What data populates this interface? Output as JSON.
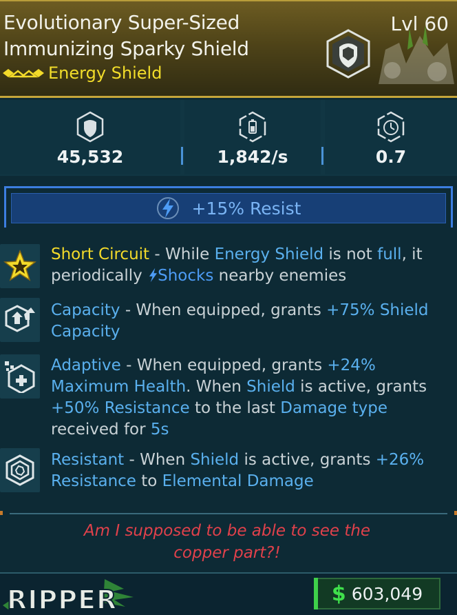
{
  "item": {
    "name_line1": "Evolutionary Super-Sized",
    "name_line2": "Immunizing Sparky Shield",
    "level": "Lvl 60",
    "type": "Energy Shield"
  },
  "stats": [
    {
      "icon": "shield-capacity-icon",
      "value": "45,532"
    },
    {
      "icon": "recharge-rate-icon",
      "value": "1,842/s"
    },
    {
      "icon": "recharge-delay-icon",
      "value": "0.7"
    }
  ],
  "banner": {
    "icon": "lightning-bolt-icon",
    "text": "+15% Resist"
  },
  "perks": [
    {
      "icon": "short-circuit-star-icon",
      "segments": [
        {
          "text": "Short Circuit",
          "style": "gold"
        },
        {
          "text": " - While ",
          "style": "plain"
        },
        {
          "text": "Energy Shield",
          "style": "blue"
        },
        {
          "text": " is not ",
          "style": "plain"
        },
        {
          "text": "full",
          "style": "blue"
        },
        {
          "text": ", it periodically ",
          "style": "plain"
        },
        {
          "text": "Shocks",
          "style": "shock"
        },
        {
          "text": " nearby enemies",
          "style": "plain"
        }
      ]
    },
    {
      "icon": "capacity-icon",
      "segments": [
        {
          "text": "Capacity",
          "style": "blue"
        },
        {
          "text": " - When equipped, grants ",
          "style": "plain"
        },
        {
          "text": "+75% Shield Capacity",
          "style": "blue"
        }
      ]
    },
    {
      "icon": "adaptive-icon",
      "segments": [
        {
          "text": "Adaptive",
          "style": "blue"
        },
        {
          "text": " - When equipped, grants ",
          "style": "plain"
        },
        {
          "text": "+24% Maximum Health",
          "style": "blue"
        },
        {
          "text": ". When ",
          "style": "plain"
        },
        {
          "text": "Shield",
          "style": "blue"
        },
        {
          "text": " is active, grants ",
          "style": "plain"
        },
        {
          "text": "+50% Resistance",
          "style": "blue"
        },
        {
          "text": " to the last ",
          "style": "plain"
        },
        {
          "text": "Damage type",
          "style": "blue"
        },
        {
          "text": " received for ",
          "style": "plain"
        },
        {
          "text": "5s",
          "style": "blue"
        }
      ]
    },
    {
      "icon": "resistant-icon",
      "segments": [
        {
          "text": "Resistant",
          "style": "blue"
        },
        {
          "text": " - When ",
          "style": "plain"
        },
        {
          "text": "Shield",
          "style": "blue"
        },
        {
          "text": " is active, grants ",
          "style": "plain"
        },
        {
          "text": "+26% Resistance",
          "style": "blue"
        },
        {
          "text": " to ",
          "style": "plain"
        },
        {
          "text": "Elemental Damage",
          "style": "blue"
        }
      ]
    }
  ],
  "quote_line1": "Am I supposed to be able to see the",
  "quote_line2": "copper part?!",
  "footer": {
    "brand": "RIPPER",
    "currency_icon": "$",
    "price": "603,049"
  },
  "colors": {
    "rarity_gold": "#f3da2a",
    "stat_blue": "#5ab0ee",
    "quote_red": "#e0414b",
    "money_green": "#3fe04b"
  }
}
